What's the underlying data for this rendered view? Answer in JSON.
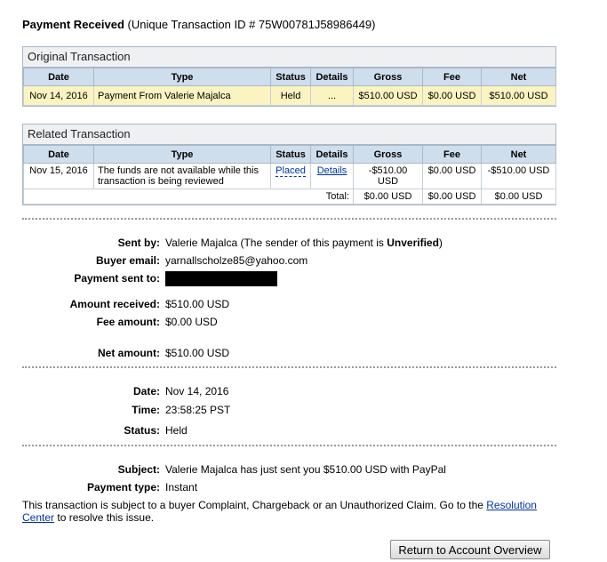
{
  "header": {
    "title_bold": "Payment Received",
    "title_rest": "(Unique Transaction ID # 75W00781J58986449)"
  },
  "original": {
    "heading": "Original Transaction",
    "columns": [
      "Date",
      "Type",
      "Status",
      "Details",
      "Gross",
      "Fee",
      "Net"
    ],
    "row": {
      "date": "Nov 14, 2016",
      "type": "Payment From Valerie Majalca",
      "status": "Held",
      "details": "...",
      "gross": "$510.00 USD",
      "fee": "$0.00 USD",
      "net": "$510.00 USD"
    }
  },
  "related": {
    "heading": "Related Transaction",
    "columns": [
      "Date",
      "Type",
      "Status",
      "Details",
      "Gross",
      "Fee",
      "Net"
    ],
    "row": {
      "date": "Nov 15, 2016",
      "type": "The funds are not available while this transaction is being reviewed",
      "status": "Placed",
      "details": "Details",
      "gross": "-$510.00 USD",
      "fee": "$0.00 USD",
      "net": "-$510.00 USD"
    },
    "total": {
      "label": "Total:",
      "gross": "$0.00 USD",
      "fee": "$0.00 USD",
      "net": "$0.00 USD"
    }
  },
  "details": {
    "sent_by_label": "Sent by:",
    "sent_by_value": "Valerie Majalca (The sender of this payment is ",
    "sent_by_status": "Unverified",
    "sent_by_close": ")",
    "buyer_email_label": "Buyer email:",
    "buyer_email_value": "yarnallscholze85@yahoo.com",
    "sent_to_label": "Payment sent to:",
    "amount_label": "Amount received:",
    "amount_value": "$510.00 USD",
    "fee_label": "Fee amount:",
    "fee_value": "$0.00 USD",
    "net_label": "Net amount:",
    "net_value": "$510.00 USD",
    "date_label": "Date:",
    "date_value": "Nov 14, 2016",
    "time_label": "Time:",
    "time_value": "23:58:25 PST",
    "status_label": "Status:",
    "status_value": "Held",
    "subject_label": "Subject:",
    "subject_value": "Valerie Majalca has just sent you $510.00 USD with PayPal",
    "ptype_label": "Payment type:",
    "ptype_value": "Instant"
  },
  "notice": {
    "text_before": "This transaction is subject to a buyer Complaint, Chargeback or an Unauthorized Claim. Go to the ",
    "link": "Resolution Center",
    "text_after": " to resolve this issue."
  },
  "button": {
    "label": "Return to Account Overview"
  }
}
